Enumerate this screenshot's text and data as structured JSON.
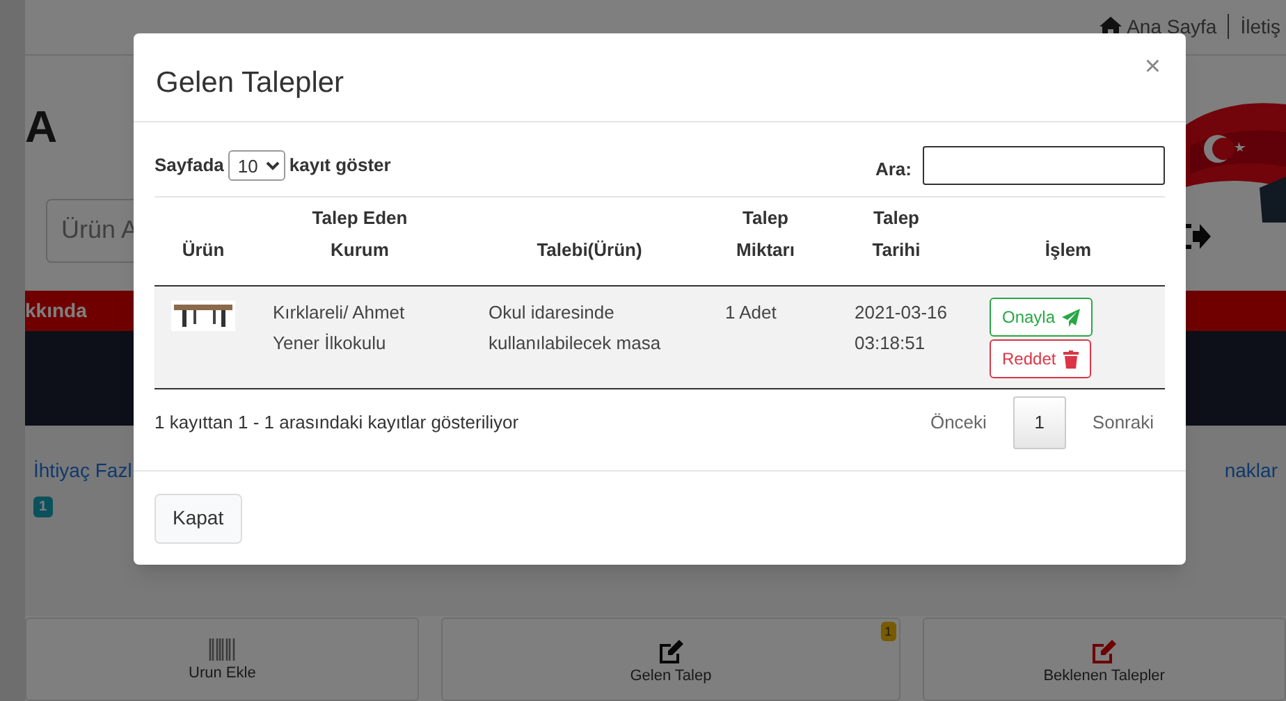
{
  "background_page": {
    "top_links": [
      {
        "label": "Ana Sayfa",
        "kind": "home"
      },
      {
        "label": "İletiş",
        "kind": "plain"
      }
    ],
    "logo": "A",
    "search": {
      "placeholder": "Ürün A"
    },
    "red_nav": {
      "label": "kkında"
    },
    "left_link": {
      "label": "İhtiyaç Fazl",
      "badge": "1"
    },
    "right_link": {
      "label": "naklar"
    },
    "cards": [
      {
        "label": "Urun Ekle",
        "kind": "barcode"
      },
      {
        "label": "Gelen Talep",
        "kind": "edit",
        "badge": "1"
      },
      {
        "label": "Beklenen Talepler",
        "kind": "edit-red"
      }
    ]
  },
  "modal": {
    "title": "Gelen Talepler",
    "close": "×",
    "length_before": "Sayfada",
    "page_size": "10",
    "length_after": "kayıt göster",
    "search_label": "Ara:",
    "columns": [
      "Ürün",
      "Talep Eden Kurum",
      "Talebi(Ürün)",
      "Talep Miktarı",
      "Talep Tarihi",
      "İşlem"
    ],
    "rows": [
      {
        "kurum": "Kırklareli/ Ahmet Yener İlkokulu",
        "talep": "Okul idaresinde kullanılabilecek masa",
        "miktar": "1 Adet",
        "tarih": "2021-03-16 03:18:51",
        "actions": [
          {
            "label": "Onayla",
            "kind": "approve"
          },
          {
            "label": "Reddet",
            "kind": "reject"
          }
        ]
      }
    ],
    "info": "1 kayıttan 1 - 1 arasındaki kayıtlar gösteriliyor",
    "pagination": [
      {
        "label": "Önceki",
        "selected": false
      },
      {
        "label": "1",
        "selected": true
      },
      {
        "label": "Sonraki",
        "selected": false
      }
    ],
    "buttons": [
      "Kapat"
    ]
  }
}
